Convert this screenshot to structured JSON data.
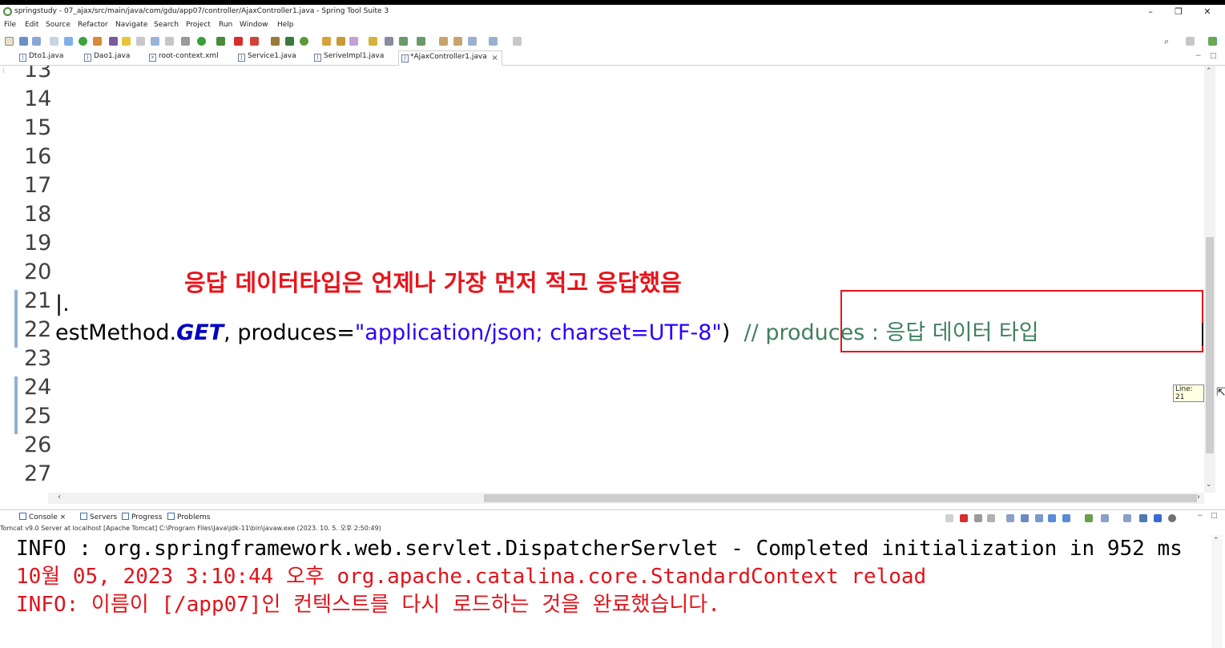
{
  "window": {
    "title": "springstudy - 07_ajax/src/main/java/com/gdu/app07/controller/AjaxController1.java - Spring Tool Suite 3",
    "controls": [
      "–",
      "❐",
      "✕"
    ]
  },
  "menu": [
    "File",
    "Edit",
    "Source",
    "Refactor",
    "Navigate",
    "Search",
    "Project",
    "Run",
    "Window",
    "Help"
  ],
  "tabs": [
    {
      "label": "Dto1.java",
      "icon": "java-file-icon",
      "active": false
    },
    {
      "label": "Dao1.java",
      "icon": "java-file-icon",
      "active": false
    },
    {
      "label": "root-context.xml",
      "icon": "xml-file-icon",
      "active": false
    },
    {
      "label": "Service1.java",
      "icon": "java-file-icon",
      "active": false
    },
    {
      "label": "SeriveImpl1.java",
      "icon": "java-file-icon",
      "active": false
    },
    {
      "label": "*AjaxController1.java",
      "icon": "java-file-icon",
      "active": true
    }
  ],
  "editor": {
    "line_numbers": [
      "13",
      "14",
      "15",
      "16",
      "17",
      "18",
      "19",
      "20",
      "21",
      "22",
      "23",
      "24",
      "25",
      "26",
      "27"
    ],
    "line21_text": "|.",
    "line22": {
      "prefix": "estMethod.",
      "keyword": "GET",
      "middle": ", produces=",
      "string": "\"application/json; charset=UTF-8\"",
      "paren": ")  ",
      "comment_start": "//",
      "comment_rest": " produces : 응답 데이터 타입"
    },
    "annotation": "응답 데이터타입은 언제나 가장 먼저 적고 응답했음",
    "line_tooltip": "Line: 21"
  },
  "console": {
    "tabs": [
      "Console",
      "Servers",
      "Progress",
      "Problems"
    ],
    "server_info": "Tomcat v9.0 Server at localhost [Apache Tomcat] C:\\Program Files\\Java\\jdk-11\\bin\\javaw.exe  (2023. 10. 5. 오후 2:50:49)",
    "lines": [
      {
        "text": "INFO : org.springframework.web.servlet.DispatcherServlet - Completed initialization in 952 ms",
        "color": "#000000"
      },
      {
        "text": "10월 05, 2023 3:10:44 오후 org.apache.catalina.core.StandardContext reload",
        "color": "#e0141b"
      },
      {
        "text": "INFO: 이름이 [/app07]인 컨텍스트를 다시 로드하는 것을 완료했습니다.",
        "color": "#e0141b"
      }
    ]
  },
  "colors": {
    "annotation_red": "#e8141b",
    "keyword_blue": "#0000c0",
    "string_blue": "#2a00ff",
    "comment_green": "#3f7f5f"
  }
}
